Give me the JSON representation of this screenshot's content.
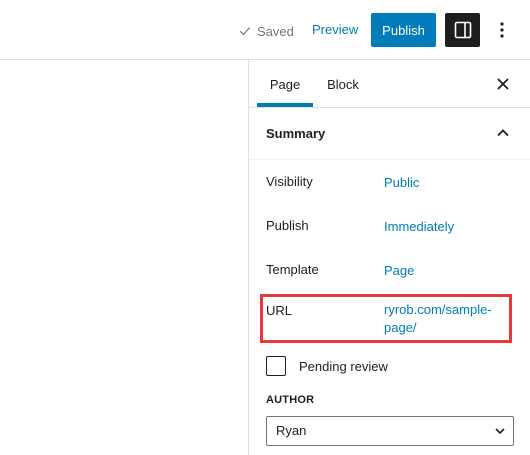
{
  "topbar": {
    "saved_label": "Saved",
    "preview_label": "Preview",
    "publish_label": "Publish"
  },
  "sidebar": {
    "tabs": [
      {
        "label": "Page",
        "active": true
      },
      {
        "label": "Block",
        "active": false
      }
    ],
    "summary": {
      "title": "Summary",
      "rows": [
        {
          "label": "Visibility",
          "value": "Public"
        },
        {
          "label": "Publish",
          "value": "Immediately"
        },
        {
          "label": "Template",
          "value": "Page"
        },
        {
          "label": "URL",
          "value": "ryrob.com/sample-page/"
        }
      ],
      "pending_review_label": "Pending review",
      "pending_review_checked": false,
      "author_label": "AUTHOR",
      "author_selected": "Ryan"
    }
  },
  "colors": {
    "accent": "#007cba",
    "highlight": "#e13b3b",
    "dark": "#1e1e1e"
  }
}
